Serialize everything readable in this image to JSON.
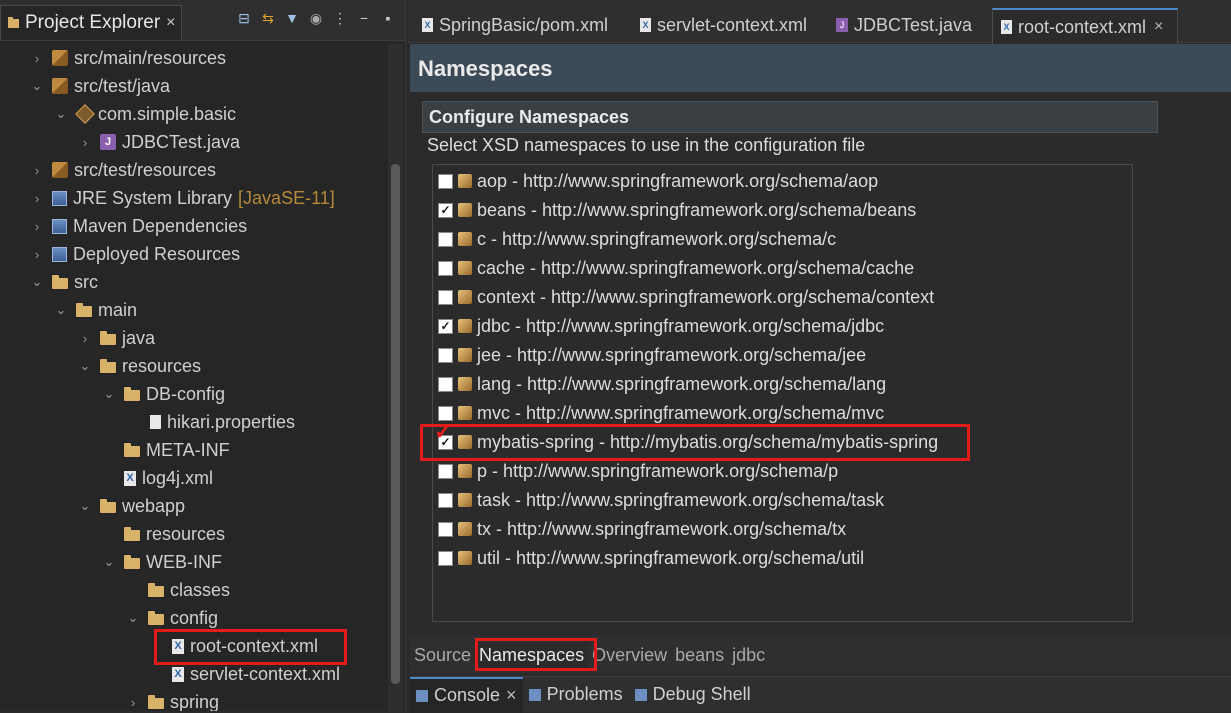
{
  "project_explorer": {
    "tab_label": "Project Explorer",
    "tree": [
      {
        "label": "src/main/resources",
        "chev": "›",
        "icon": "pkg"
      },
      {
        "label": "src/test/java",
        "chev": "⌄",
        "icon": "pkg"
      },
      {
        "label": "com.simple.basic",
        "chev": "⌄",
        "icon": "pkg-b"
      },
      {
        "label": "JDBCTest.java",
        "chev": "›",
        "icon": "jfile"
      },
      {
        "label": "src/test/resources",
        "chev": "›",
        "icon": "pkg"
      },
      {
        "label": "JRE System Library",
        "sub": "[JavaSE-11]",
        "chev": "›",
        "icon": "lib"
      },
      {
        "label": "Maven Dependencies",
        "chev": "›",
        "icon": "lib"
      },
      {
        "label": "Deployed Resources",
        "chev": "›",
        "icon": "lib"
      },
      {
        "label": "src",
        "chev": "⌄",
        "icon": "folder"
      },
      {
        "label": "main",
        "chev": "⌄",
        "icon": "folder"
      },
      {
        "label": "java",
        "chev": "›",
        "icon": "folder"
      },
      {
        "label": "resources",
        "chev": "⌄",
        "icon": "folder"
      },
      {
        "label": "DB-config",
        "chev": "⌄",
        "icon": "folder"
      },
      {
        "label": "hikari.properties",
        "chev": "",
        "icon": "pfile"
      },
      {
        "label": "META-INF",
        "chev": "",
        "icon": "folder"
      },
      {
        "label": "log4j.xml",
        "chev": "",
        "icon": "xfile"
      },
      {
        "label": "webapp",
        "chev": "⌄",
        "icon": "folder"
      },
      {
        "label": "resources",
        "chev": "",
        "icon": "folder"
      },
      {
        "label": "WEB-INF",
        "chev": "⌄",
        "icon": "folder"
      },
      {
        "label": "classes",
        "chev": "",
        "icon": "folder"
      },
      {
        "label": "config",
        "chev": "⌄",
        "icon": "folder"
      },
      {
        "label": "root-context.xml",
        "chev": "",
        "icon": "xfile"
      },
      {
        "label": "servlet-context.xml",
        "chev": "",
        "icon": "xfile"
      },
      {
        "label": "spring",
        "chev": "›",
        "icon": "folder"
      }
    ]
  },
  "editor": {
    "tabs": [
      {
        "label": "SpringBasic/pom.xml",
        "type": "xml"
      },
      {
        "label": "servlet-context.xml",
        "type": "xml"
      },
      {
        "label": "JDBCTest.java",
        "type": "java"
      },
      {
        "label": "root-context.xml",
        "type": "xml",
        "active": true
      }
    ],
    "page_title": "Namespaces",
    "section_title": "Configure Namespaces",
    "description": "Select XSD namespaces to use in the configuration file",
    "namespaces": [
      {
        "label": "aop - http://www.springframework.org/schema/aop",
        "checked": false
      },
      {
        "label": "beans - http://www.springframework.org/schema/beans",
        "checked": true
      },
      {
        "label": "c - http://www.springframework.org/schema/c",
        "checked": false
      },
      {
        "label": "cache - http://www.springframework.org/schema/cache",
        "checked": false
      },
      {
        "label": "context - http://www.springframework.org/schema/context",
        "checked": false
      },
      {
        "label": "jdbc - http://www.springframework.org/schema/jdbc",
        "checked": true
      },
      {
        "label": "jee - http://www.springframework.org/schema/jee",
        "checked": false
      },
      {
        "label": "lang - http://www.springframework.org/schema/lang",
        "checked": false
      },
      {
        "label": "mvc - http://www.springframework.org/schema/mvc",
        "checked": false
      },
      {
        "label": "mybatis-spring - http://mybatis.org/schema/mybatis-spring",
        "checked": true
      },
      {
        "label": "p - http://www.springframework.org/schema/p",
        "checked": false
      },
      {
        "label": "task - http://www.springframework.org/schema/task",
        "checked": false
      },
      {
        "label": "tx - http://www.springframework.org/schema/tx",
        "checked": false
      },
      {
        "label": "util - http://www.springframework.org/schema/util",
        "checked": false
      }
    ],
    "bottom_tabs": [
      "Source",
      "Namespaces",
      "Overview",
      "beans",
      "jdbc"
    ],
    "active_bottom_tab": "Namespaces"
  },
  "console_bar": {
    "tabs": [
      "Console",
      "Problems",
      "Debug Shell"
    ]
  },
  "colors": {
    "highlight": "#e31b1b",
    "accent": "#4a86c8"
  }
}
